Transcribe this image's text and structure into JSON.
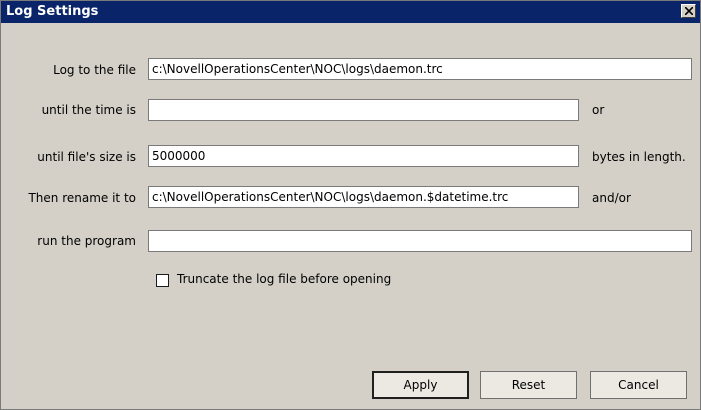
{
  "window": {
    "title": "Log Settings"
  },
  "form": {
    "log_file": {
      "label": "Log to the file",
      "value": "c:\\NovellOperationsCenter\\NOC\\logs\\daemon.trc"
    },
    "until_time": {
      "label": "until the time is",
      "value": "",
      "suffix": "or"
    },
    "until_size": {
      "label": "until file's size is",
      "value": "5000000",
      "suffix": "bytes in length."
    },
    "rename": {
      "label": "Then rename it to",
      "value": "c:\\NovellOperationsCenter\\NOC\\logs\\daemon.$datetime.trc",
      "suffix": "and/or"
    },
    "run_program": {
      "label": "run the program",
      "value": ""
    },
    "truncate": {
      "label": "Truncate the log file before opening",
      "checked": false
    }
  },
  "buttons": {
    "apply": "Apply",
    "reset": "Reset",
    "cancel": "Cancel"
  }
}
